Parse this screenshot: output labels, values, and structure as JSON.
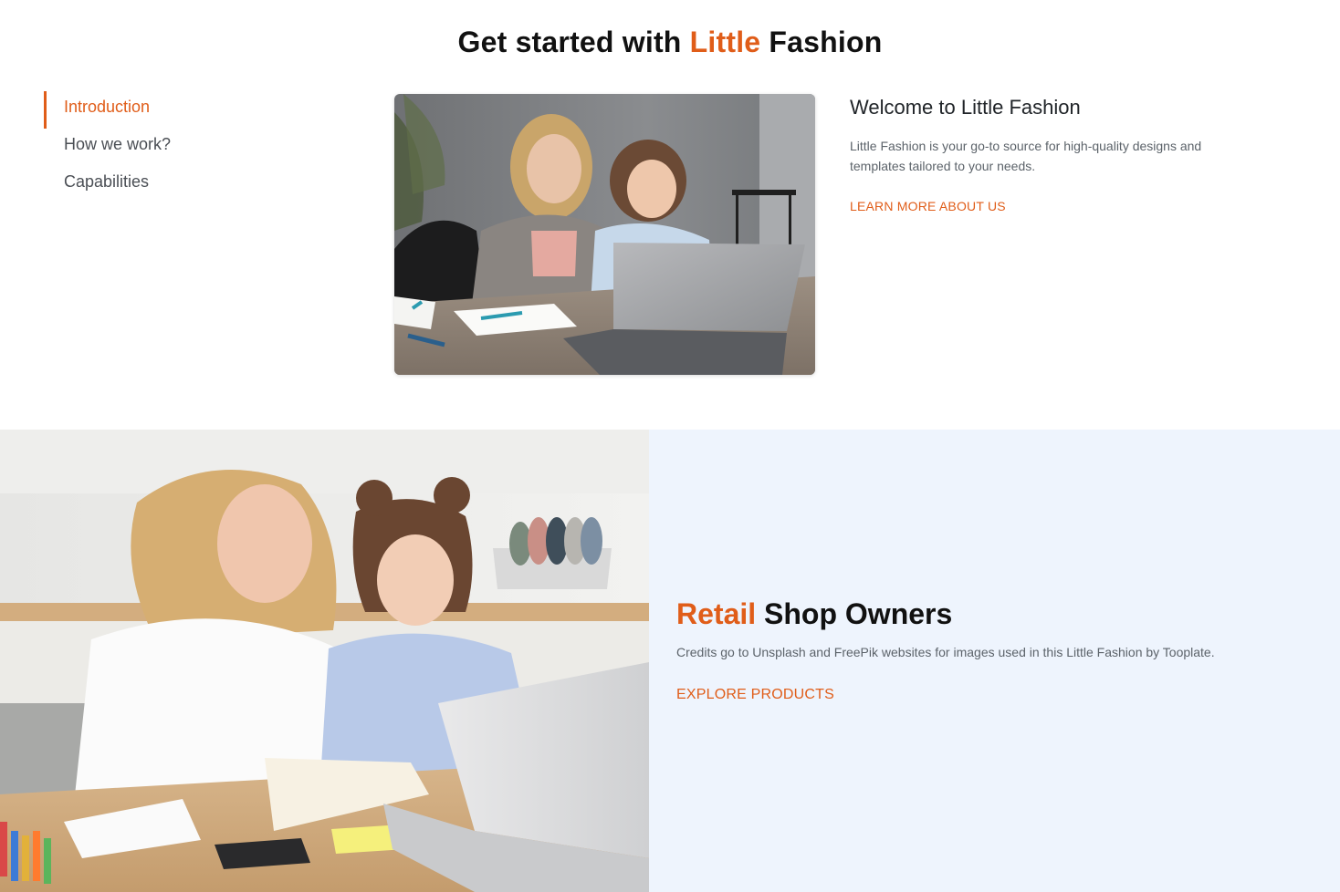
{
  "intro": {
    "heading_prefix": "Get started with ",
    "heading_accent": "Little",
    "heading_suffix": " Fashion"
  },
  "side_nav": {
    "items": [
      {
        "label": "Introduction",
        "active": true
      },
      {
        "label": "How we work?",
        "active": false
      },
      {
        "label": "Capabilities",
        "active": false
      }
    ]
  },
  "welcome": {
    "title": "Welcome to Little Fashion",
    "text": "Little Fashion is your go-to source for high-quality designs and templates tailored to your needs.",
    "link": "LEARN MORE ABOUT US"
  },
  "retail": {
    "title_accent": "Retail",
    "title_rest": " Shop Owners",
    "text": "Credits go to Unsplash and FreePik websites for images used in this Little Fashion by Tooplate.",
    "link": "EXPLORE PRODUCTS"
  },
  "colors": {
    "accent": "#e05d19",
    "panel_bg": "#eef4fd",
    "text_dark": "#111111",
    "text_muted": "#5c636a"
  }
}
